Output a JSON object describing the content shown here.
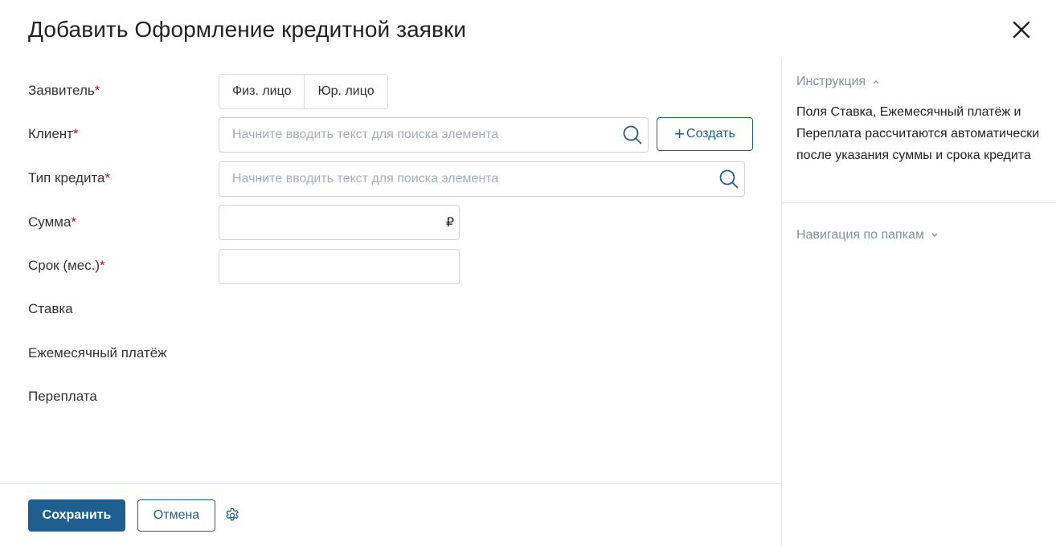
{
  "dialog": {
    "title": "Добавить Оформление кредитной заявки"
  },
  "form": {
    "applicant": {
      "label": "Заявитель",
      "required_mark": "*",
      "options": [
        "Физ. лицо",
        "Юр. лицо"
      ]
    },
    "client": {
      "label": "Клиент",
      "required_mark": "*",
      "placeholder": "Начните вводить текст для поиска элемента",
      "create_plus": "+",
      "create_label": "Создать"
    },
    "credit_type": {
      "label": "Тип кредита",
      "required_mark": "*",
      "placeholder": "Начните вводить текст для поиска элемента"
    },
    "amount": {
      "label": "Сумма",
      "required_mark": "*",
      "currency_symbol": "₽"
    },
    "term": {
      "label": "Срок (мес.)",
      "required_mark": "*"
    },
    "rate": {
      "label": "Ставка"
    },
    "monthly_payment": {
      "label": "Ежемесячный платёж"
    },
    "overpayment": {
      "label": "Переплата"
    }
  },
  "footer": {
    "save_label": "Сохранить",
    "cancel_label": "Отмена"
  },
  "side_panel": {
    "instructions_title": "Инструкция",
    "instructions_text": "Поля Ставка, Ежемесячный платёж и Переплата рассчитаются автоматически после указания суммы и срока кредита",
    "folder_nav_title": "Навигация по папкам"
  },
  "icons": {
    "close": "close-icon",
    "search": "search-icon",
    "gear": "gear-icon",
    "chevron_up": "chevron-up-icon",
    "chevron_down": "chevron-down-icon"
  },
  "colors": {
    "primary": "#1f5f8f",
    "required": "#d0021b",
    "muted": "#8a9099"
  }
}
